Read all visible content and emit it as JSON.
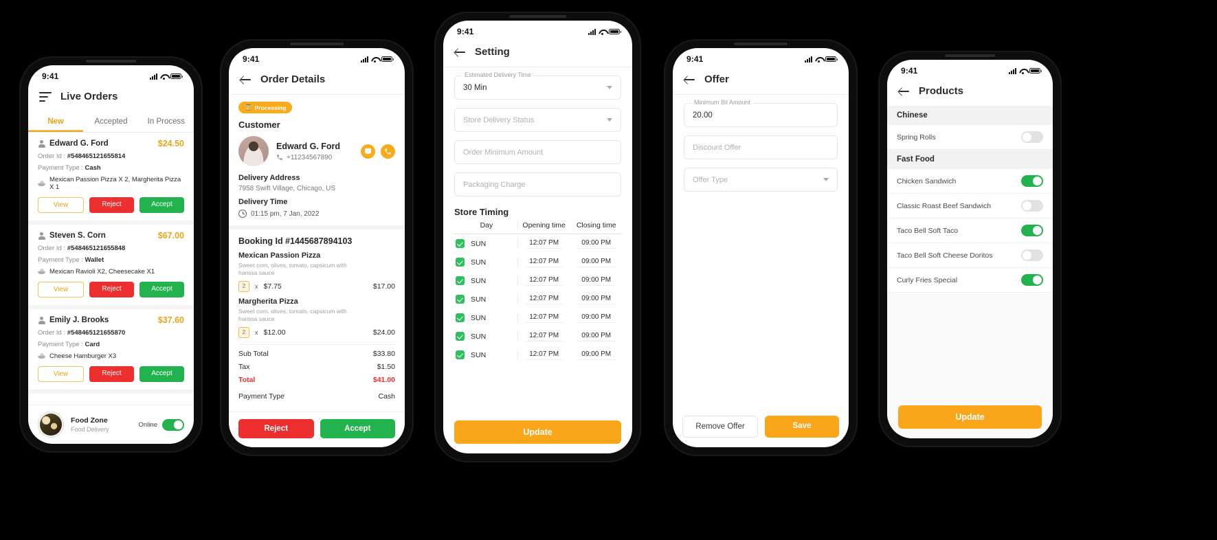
{
  "phones": {
    "live_orders": {
      "status": {
        "time": "9:41"
      },
      "title": "Live Orders",
      "menu_icon": "hamburger-icon",
      "tabs": [
        {
          "label": "New",
          "active": true
        },
        {
          "label": "Accepted",
          "active": false
        },
        {
          "label": "In Process",
          "active": false
        }
      ],
      "orders": [
        {
          "name": "Edward G. Ford",
          "amount": "$24.50",
          "order_id_label": "Order Id :",
          "order_id": "#548465121655814",
          "payment_label": "Payment Type :",
          "payment": "Cash",
          "items": "Mexican Passion Pizza X 2, Margherita Pizza X 1",
          "buttons": {
            "view": "View",
            "reject": "Reject",
            "accept": "Accept"
          }
        },
        {
          "name": "Steven S. Corn",
          "amount": "$67.00",
          "order_id_label": "Order Id :",
          "order_id": "#548465121655848",
          "payment_label": "Payment Type :",
          "payment": "Wallet",
          "items": "Mexican Ravioli X2, Cheesecake X1",
          "buttons": {
            "view": "View",
            "reject": "Reject",
            "accept": "Accept"
          }
        },
        {
          "name": "Emily J. Brooks",
          "amount": "$37.60",
          "order_id_label": "Order Id :",
          "order_id": "#548465121655870",
          "payment_label": "Payment Type :",
          "payment": "Card",
          "items": "Cheese Hamburger X3",
          "buttons": {
            "view": "View",
            "reject": "Reject",
            "accept": "Accept"
          }
        }
      ],
      "store": {
        "name": "Food Zone",
        "subtitle": "Food Delivery",
        "online_label": "Online",
        "online": true
      }
    },
    "order_details": {
      "status": {
        "time": "9:41"
      },
      "title": "Order Details",
      "badge": "Processing",
      "customer_heading": "Customer",
      "customer": {
        "name": "Edward G. Ford",
        "phone": "+11234567890"
      },
      "delivery_address_label": "Delivery Address",
      "delivery_address": "7958 Swift Village, Chicago, US",
      "delivery_time_label": "Delivery Time",
      "delivery_time": "01:15 pm, 7 Jan, 2022",
      "booking_id": "Booking Id #1445687894103",
      "items": [
        {
          "name": "Mexican Passion Pizza",
          "desc": "Sweet corn, olives, tomato, capsicum with harissa sauce",
          "qty": "2",
          "x": "x",
          "unit_price": "$7.75",
          "line_total": "$17.00"
        },
        {
          "name": "Margherita Pizza",
          "desc": "Sweet corn, olives, tomato, capsicum with harissa sauce",
          "qty": "2",
          "x": "x",
          "unit_price": "$12.00",
          "line_total": "$24.00"
        }
      ],
      "totals": [
        {
          "label": "Sub Total",
          "value": "$33.80"
        },
        {
          "label": "Tax",
          "value": "$1.50"
        },
        {
          "label": "Total",
          "value": "$41.00"
        },
        {
          "label": "Payment Type",
          "value": "Cash"
        }
      ],
      "actions": {
        "reject": "Reject",
        "accept": "Accept"
      }
    },
    "setting": {
      "status": {
        "time": "9:41"
      },
      "title": "Setting",
      "fields": [
        {
          "label": "Estimated Delivery Time",
          "value": "30 Min",
          "placeholder": "",
          "type": "select"
        },
        {
          "label": "",
          "value": "",
          "placeholder": "Store Delivery Status",
          "type": "select"
        },
        {
          "label": "",
          "value": "",
          "placeholder": "Order Minimum Amount",
          "type": "text"
        },
        {
          "label": "",
          "value": "",
          "placeholder": "Packaging Charge",
          "type": "text"
        }
      ],
      "store_timing_heading": "Store Timing",
      "table_headers": {
        "day": "Day",
        "opening": "Opening time",
        "closing": "Closing time"
      },
      "timing_rows": [
        {
          "day": "SUN",
          "checked": true,
          "opening": "12:07 PM",
          "closing": "09:00 PM"
        },
        {
          "day": "SUN",
          "checked": true,
          "opening": "12:07 PM",
          "closing": "09:00 PM"
        },
        {
          "day": "SUN",
          "checked": true,
          "opening": "12:07 PM",
          "closing": "09:00 PM"
        },
        {
          "day": "SUN",
          "checked": true,
          "opening": "12:07 PM",
          "closing": "09:00 PM"
        },
        {
          "day": "SUN",
          "checked": true,
          "opening": "12:07 PM",
          "closing": "09:00 PM"
        },
        {
          "day": "SUN",
          "checked": true,
          "opening": "12:07 PM",
          "closing": "09:00 PM"
        },
        {
          "day": "SUN",
          "checked": true,
          "opening": "12:07 PM",
          "closing": "09:00 PM"
        }
      ],
      "update_button": "Update"
    },
    "offer": {
      "status": {
        "time": "9:41"
      },
      "title": "Offer",
      "fields": [
        {
          "label": "Minimum Bil Amount",
          "value": "20.00",
          "placeholder": "",
          "type": "text"
        },
        {
          "label": "",
          "value": "",
          "placeholder": "Discount Offer",
          "type": "text"
        },
        {
          "label": "",
          "value": "",
          "placeholder": "Offer Type",
          "type": "select"
        }
      ],
      "remove_button": "Remove Offer",
      "save_button": "Save"
    },
    "products": {
      "status": {
        "time": "9:41"
      },
      "title": "Products",
      "groups": [
        {
          "category": "Chinese",
          "items": [
            {
              "name": "Spring Rolls",
              "enabled": false
            }
          ]
        },
        {
          "category": "Fast Food",
          "items": [
            {
              "name": "Chicken Sandwich",
              "enabled": true
            },
            {
              "name": "Classic Roast Beef Sandwich",
              "enabled": false
            },
            {
              "name": "Taco Bell Soft Taco",
              "enabled": true
            },
            {
              "name": "Taco Bell Soft Cheese Doritos",
              "enabled": false
            },
            {
              "name": "Curly Fries Special",
              "enabled": true
            }
          ]
        }
      ],
      "update_button": "Update"
    }
  },
  "colors": {
    "accent": "#f9a61a",
    "accent_tab": "#e8a517",
    "reject": "#ed2f2f",
    "accept": "#22b34f",
    "green_toggle": "#22b34f"
  }
}
